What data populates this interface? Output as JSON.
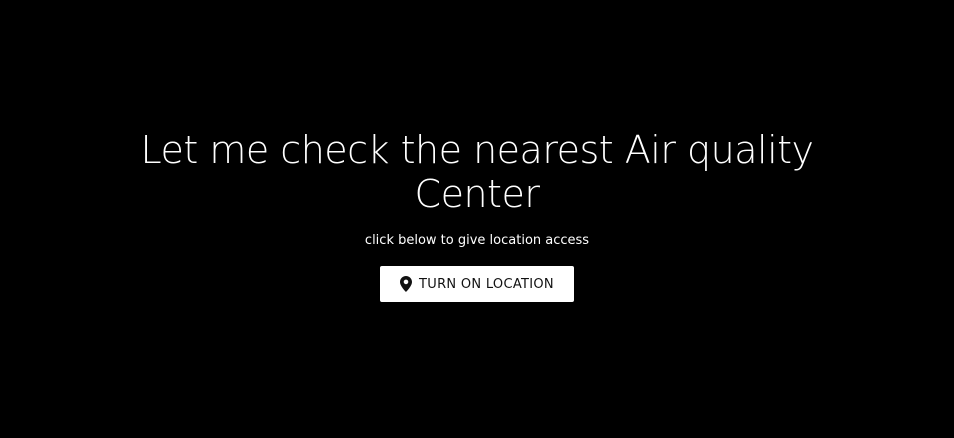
{
  "hero": {
    "title": "Let me check the nearest Air quality Center",
    "subtitle": "click below to give location access",
    "button_label": "TURN ON LOCATION",
    "button_icon": "location-pin-icon"
  },
  "colors": {
    "background": "#000000",
    "text": "#ffffff",
    "button_bg": "#ffffff",
    "button_text": "#111111"
  }
}
